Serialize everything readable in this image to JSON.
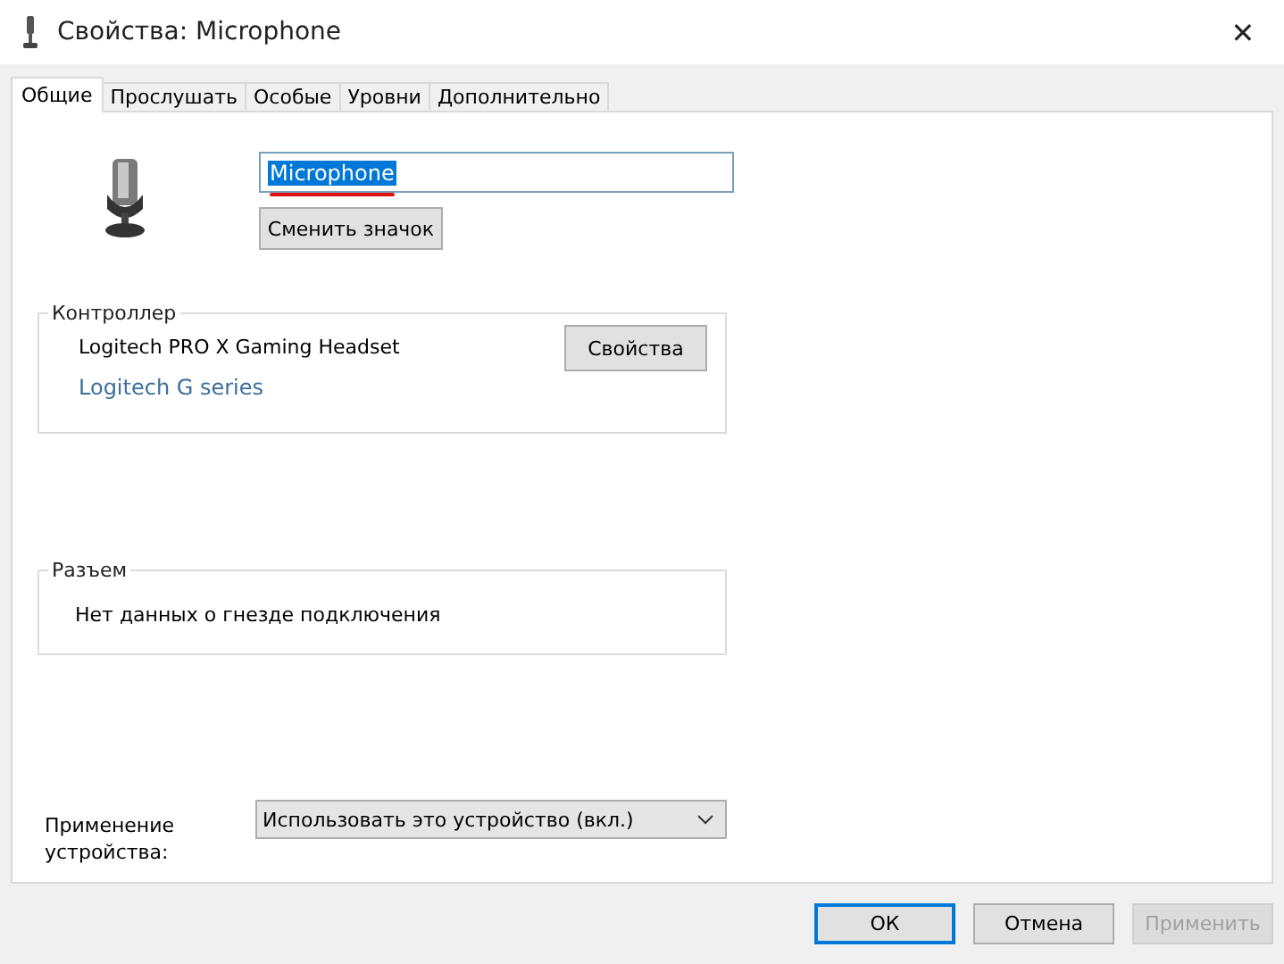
{
  "window": {
    "title": "Свойства: Microphone",
    "close": "✕"
  },
  "tabs": [
    {
      "label": "Общие",
      "selected": true
    },
    {
      "label": "Прослушать",
      "selected": false
    },
    {
      "label": "Особые",
      "selected": false
    },
    {
      "label": "Уровни",
      "selected": false
    },
    {
      "label": "Дополнительно",
      "selected": false
    }
  ],
  "device": {
    "name": "Microphone",
    "name_selected": true,
    "underlined": true,
    "change_icon_button": "Сменить значок"
  },
  "controller": {
    "title": "Контроллер",
    "name": "Logitech PRO X Gaming Headset",
    "link": "Logitech G series",
    "button": "Свойства"
  },
  "jack": {
    "title": "Разъем",
    "info": "Нет данных о гнезде подключения"
  },
  "usage": {
    "label": "Применение устройства:",
    "value": "Использовать это устройство (вкл.)"
  },
  "buttons": [
    {
      "label": "ОК",
      "kind": "default",
      "disabled": false
    },
    {
      "label": "Отмена",
      "kind": "normal",
      "disabled": false
    },
    {
      "label": "Применить",
      "kind": "normal",
      "disabled": true
    }
  ]
}
